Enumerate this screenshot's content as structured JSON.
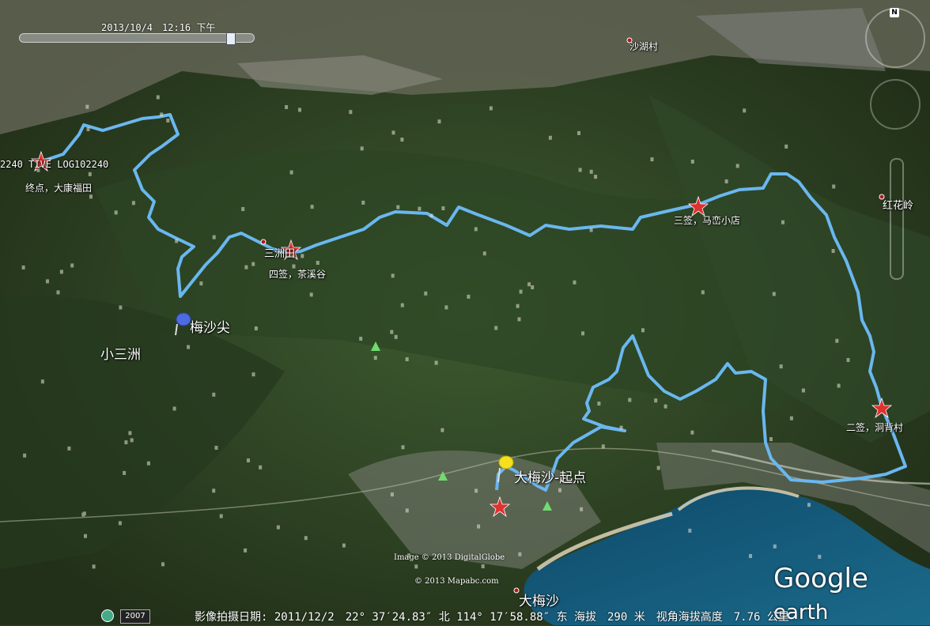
{
  "timebar": {
    "date": "2013/10/4　12:16 下午"
  },
  "compass": {
    "north": "N"
  },
  "places": {
    "shahu": "沙湖村",
    "honghualing": "红花岭",
    "sanzhoutian": "三洲田",
    "meishajian": "梅沙尖",
    "xiaosanzhou": "小三洲",
    "start": "大梅沙-起点",
    "dameisha": "大梅沙"
  },
  "checkpoints": {
    "end": "终点，大康福田",
    "track_id": "2240  TIVE LOG102240",
    "fourth": "四签，茶溪谷",
    "third": "三签，马峦小店",
    "second": "二签，洞背村"
  },
  "credits": {
    "image": "Image © 2013 DigitalGlobe",
    "mapabc": "© 2013 Mapabc.com"
  },
  "status": {
    "year": "2007",
    "text": "影像拍摄日期: 2011/12/2　22° 37′24.83″ 北 114° 17′58.88″ 东 海拔　290 米　视角海拔高度　7.76 公里"
  },
  "logo": {
    "google": "Google",
    "earth": "earth"
  }
}
